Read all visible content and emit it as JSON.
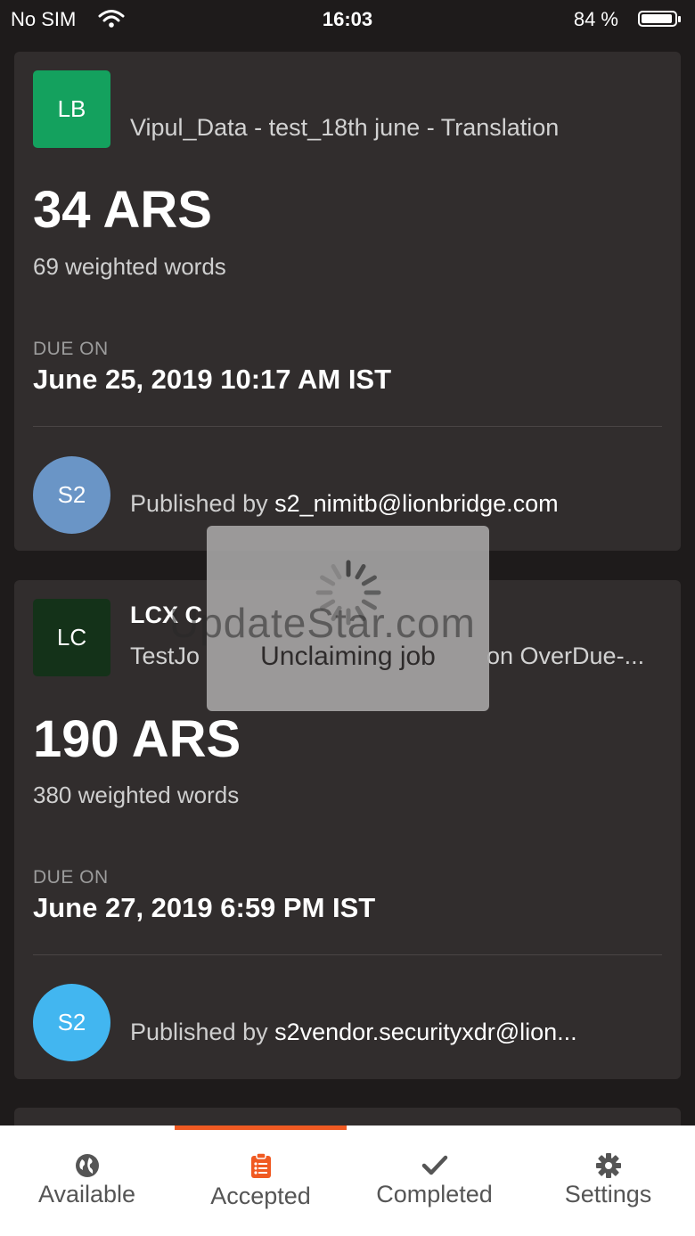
{
  "status_bar": {
    "carrier": "No SIM",
    "time": "16:03",
    "battery": "84 %"
  },
  "jobs": [
    {
      "initials": "LB",
      "avatar_color": "#14a15e",
      "title": "Vipul_Data - test_18th june - Translation",
      "amount": "34 ARS",
      "words": "69 weighted words",
      "due_label": "DUE ON",
      "due_date": "June 25, 2019 10:17 AM IST",
      "publisher_initials": "S2",
      "publisher_color": "#6a95c6",
      "published_prefix": "Published by ",
      "publisher": "s2_nimitb@lionbridge.com"
    },
    {
      "initials": "LC",
      "avatar_color": "#143219",
      "title": "LCX C",
      "subtitle": "TestJo",
      "subtitle_right": "on OverDue-...",
      "amount": "190 ARS",
      "words": "380 weighted words",
      "due_label": "DUE ON",
      "due_date": "June 27, 2019 6:59 PM IST",
      "publisher_initials": "S2",
      "publisher_color": "#42b6f0",
      "published_prefix": "Published by ",
      "publisher": "s2vendor.securityxdr@lion..."
    }
  ],
  "loading": {
    "text": "Unclaiming job"
  },
  "watermark": "UpdateStar.com",
  "tabs": [
    {
      "label": "Available",
      "icon": "globe-icon"
    },
    {
      "label": "Accepted",
      "icon": "clipboard-icon",
      "active": true
    },
    {
      "label": "Completed",
      "icon": "checkmark-icon"
    },
    {
      "label": "Settings",
      "icon": "gear-icon"
    }
  ],
  "colors": {
    "accent": "#f05a22",
    "background": "#1e1b1b",
    "card": "#312d2d"
  }
}
